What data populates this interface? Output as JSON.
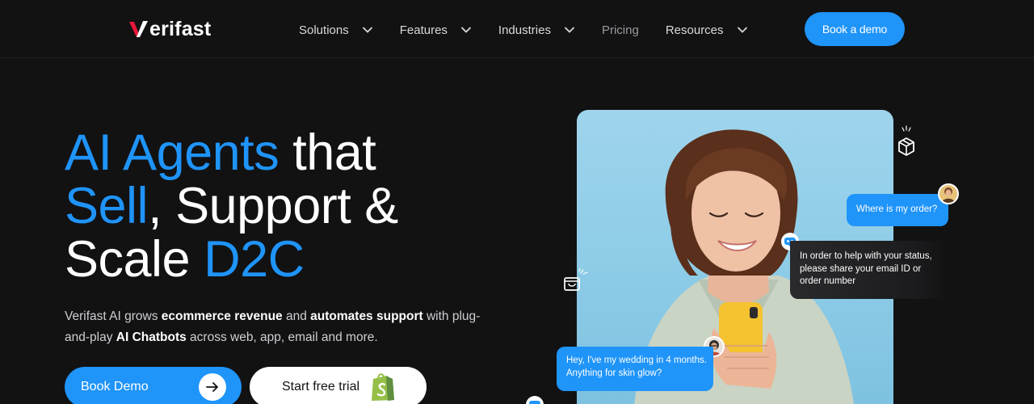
{
  "nav": {
    "logo_text": "erifast",
    "items": [
      {
        "label": "Solutions",
        "has_dropdown": true
      },
      {
        "label": "Features",
        "has_dropdown": true
      },
      {
        "label": "Industries",
        "has_dropdown": true
      },
      {
        "label": "Pricing",
        "has_dropdown": false
      },
      {
        "label": "Resources",
        "has_dropdown": true
      }
    ],
    "cta_label": "Book a demo"
  },
  "hero": {
    "headline": {
      "l1_blue": "AI Agents",
      "l1_white": " that",
      "l2_blue": "Sell",
      "l2_white": ", Support &",
      "l3_white": "Scale ",
      "l3_blue": "D2C"
    },
    "subtext": {
      "p1": "Verifast AI grows ",
      "b1": "ecommerce revenue",
      "p2": " and ",
      "b2": "automates support",
      "p3": " with plug-and-play ",
      "b3": "AI Chatbots",
      "p4": " across web, app, email and more."
    },
    "primary_button": "Book Demo",
    "secondary_button": "Start free trial"
  },
  "chat": {
    "customer_question": "Where is my order?",
    "bot_reply": "In order to help with your status, please share your email ID or order number",
    "customer_wedding": "Hey, I've my wedding in 4 months. Anything for skin glow?"
  },
  "colors": {
    "background": "#121213",
    "accent": "#1f94f9",
    "logo_mark": "#e8173a",
    "shopify_green": "#95bf47"
  },
  "icons": [
    "chevron-down-icon",
    "arrow-right-icon",
    "shopify-icon",
    "package-box-icon",
    "shopping-bag-icon",
    "chatbot-icon"
  ]
}
